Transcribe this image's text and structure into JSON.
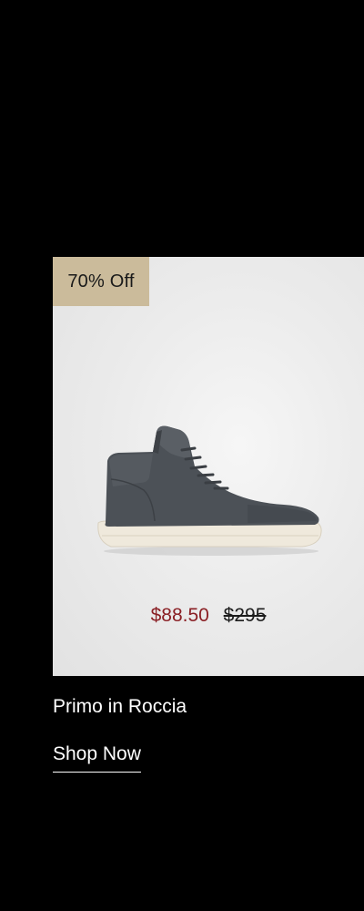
{
  "product": {
    "badge": "70% Off",
    "sale_price": "$88.50",
    "original_price": "$295",
    "name": "Primo in Roccia",
    "image_alt": "grey suede high-top sneaker",
    "cta_label": "Shop Now"
  },
  "colors": {
    "background": "#000000",
    "badge": "#cbbb9b",
    "sale_price": "#8a1f24",
    "card": "#ececec"
  }
}
